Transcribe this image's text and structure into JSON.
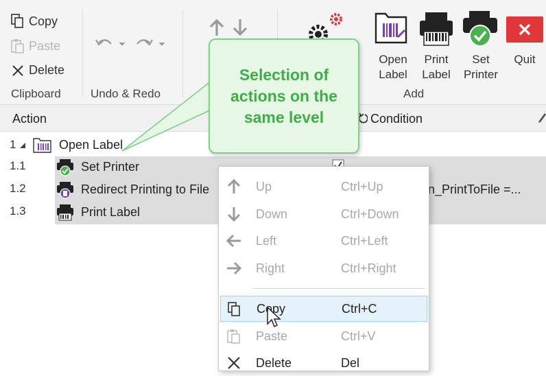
{
  "ribbon": {
    "clipboard": {
      "copy": "Copy",
      "paste": "Paste",
      "delete": "Delete",
      "group": "Clipboard"
    },
    "undo_redo": {
      "group": "Undo & Redo"
    },
    "add": {
      "open_label": [
        "Open",
        "Label"
      ],
      "print_label": [
        "Print",
        "Label"
      ],
      "set_printer": [
        "Set",
        "Printer"
      ],
      "quit": "Quit",
      "group": "Add"
    }
  },
  "header": {
    "action": "Action",
    "condition": "Condition"
  },
  "tree": [
    {
      "num": "1",
      "label": "Open Label"
    },
    {
      "num": "1.1",
      "label": "Set Printer"
    },
    {
      "num": "1.2",
      "label": "Redirect Printing to File",
      "condition": "n_PrintToFile =..."
    },
    {
      "num": "1.3",
      "label": "Print Label"
    }
  ],
  "callout": {
    "lines": [
      "Selection of",
      "actions on the",
      "same level"
    ]
  },
  "context_menu": {
    "items": [
      {
        "label": "Up",
        "shortcut": "Ctrl+Up",
        "icon": "arrow-up-icon"
      },
      {
        "label": "Down",
        "shortcut": "Ctrl+Down",
        "icon": "arrow-down-icon"
      },
      {
        "label": "Left",
        "shortcut": "Ctrl+Left",
        "icon": "arrow-left-icon"
      },
      {
        "label": "Right",
        "shortcut": "Ctrl+Right",
        "icon": "arrow-right-icon"
      },
      {
        "label": "Copy",
        "shortcut": "Ctrl+C",
        "icon": "copy-icon"
      },
      {
        "label": "Paste",
        "shortcut": "Ctrl+V",
        "icon": "paste-icon"
      },
      {
        "label": "Delete",
        "shortcut": "Del",
        "icon": "delete-icon"
      }
    ]
  },
  "colors": {
    "callout_text": "#3fae49",
    "callout_bg": "#e6f7e5",
    "quit_button": "#e0383a",
    "purple_accent": "#7a3fb0",
    "check_green": "#4caf50"
  }
}
